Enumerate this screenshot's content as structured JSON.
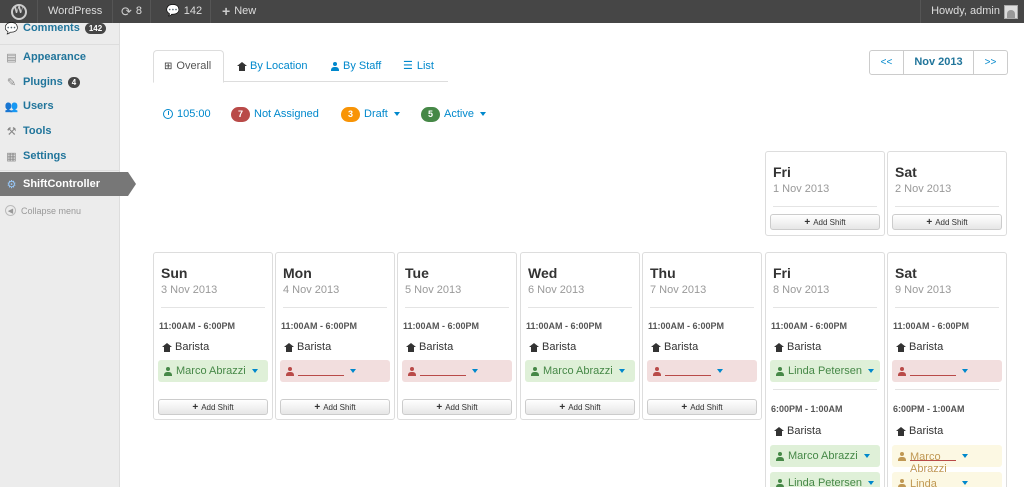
{
  "adminbar": {
    "site_name": "WordPress",
    "updates_count": "8",
    "comments_count": "142",
    "new_label": "New",
    "howdy": "Howdy, admin"
  },
  "sidebar": {
    "comments": {
      "label": "Comments",
      "badge": "142"
    },
    "appearance": "Appearance",
    "plugins": {
      "label": "Plugins",
      "badge": "4"
    },
    "users": "Users",
    "tools": "Tools",
    "settings": "Settings",
    "shiftcontroller": "ShiftController",
    "collapse": "Collapse menu"
  },
  "tabs": [
    "Overall",
    "By Location",
    "By Staff",
    "List"
  ],
  "month_nav": {
    "prev": "<<",
    "current": "Nov 2013",
    "next": ">>"
  },
  "status": {
    "hours": "105:00",
    "not_assigned": {
      "count": "7",
      "label": "Not Assigned",
      "color": "#b94a48"
    },
    "draft": {
      "count": "3",
      "label": "Draft",
      "color": "#f89406"
    },
    "active": {
      "count": "5",
      "label": "Active",
      "color": "#468847"
    }
  },
  "add_shift_label": "Add Shift",
  "location": "Barista",
  "week1": [
    {
      "name": "Fri",
      "date": "1 Nov 2013"
    },
    {
      "name": "Sat",
      "date": "2 Nov 2013"
    }
  ],
  "week2": [
    {
      "name": "Sun",
      "date": "3 Nov 2013",
      "time": "11:00AM - 6:00PM",
      "staff": "Marco Abrazzi",
      "state": "ok"
    },
    {
      "name": "Mon",
      "date": "4 Nov 2013",
      "time": "11:00AM - 6:00PM",
      "staff": "",
      "state": "no"
    },
    {
      "name": "Tue",
      "date": "5 Nov 2013",
      "time": "11:00AM - 6:00PM",
      "staff": "",
      "state": "no"
    },
    {
      "name": "Wed",
      "date": "6 Nov 2013",
      "time": "11:00AM - 6:00PM",
      "staff": "Marco Abrazzi",
      "state": "ok"
    },
    {
      "name": "Thu",
      "date": "7 Nov 2013",
      "time": "11:00AM - 6:00PM",
      "staff": "",
      "state": "no"
    },
    {
      "name": "Fri",
      "date": "8 Nov 2013",
      "time": "11:00AM - 6:00PM",
      "staff": "Linda Petersen",
      "state": "ok",
      "time2": "6:00PM - 1:00AM",
      "staff2": "Marco Abrazzi",
      "state2": "ok",
      "staff3": "Linda Petersen",
      "state3": "ok"
    },
    {
      "name": "Sat",
      "date": "9 Nov 2013",
      "time": "11:00AM - 6:00PM",
      "staff": "",
      "state": "no",
      "time2": "6:00PM - 1:00AM",
      "staff2": "Marco Abrazzi",
      "state2": "draft",
      "staff3": "Linda Petersen",
      "state3": "draft"
    }
  ]
}
